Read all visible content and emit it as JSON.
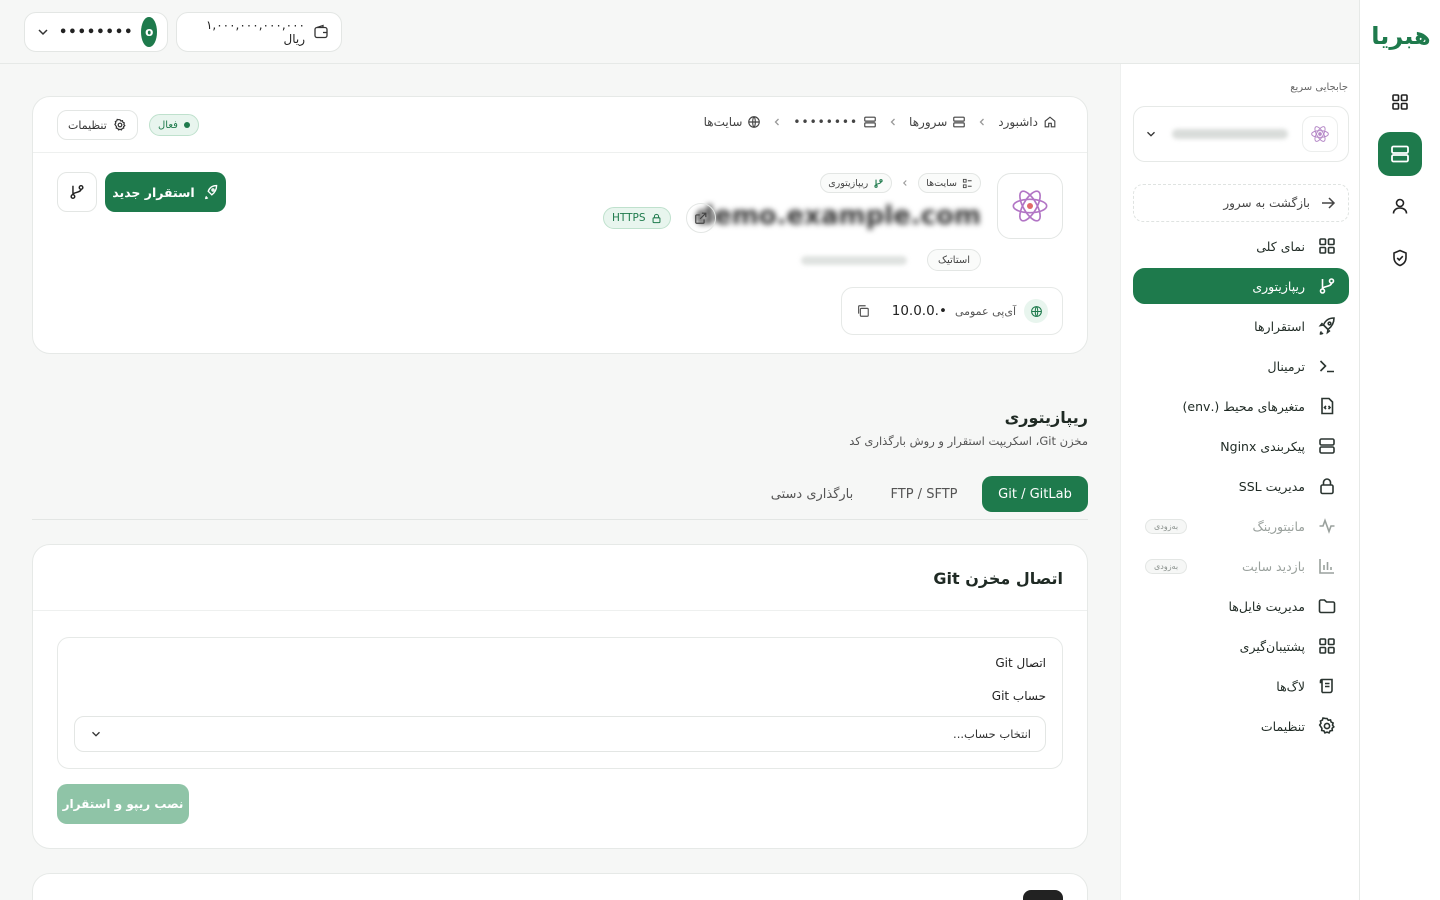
{
  "topbar": {
    "user": {
      "avatar_initial": "o",
      "name": "••••••••"
    },
    "wallet": {
      "balance": "۱,۰۰۰,۰۰۰,۰۰۰,۰۰۰ ریال"
    }
  },
  "rail": {
    "logo": "هبریا",
    "items": [
      {
        "icon": "grid-icon",
        "active": false
      },
      {
        "icon": "server-icon",
        "active": true
      },
      {
        "icon": "user-icon",
        "active": false
      },
      {
        "icon": "shield-icon",
        "active": false
      }
    ]
  },
  "sidebar": {
    "quick_switch_label": "جابجایی سریع",
    "back_label": "بازگشت به سرور",
    "items": [
      {
        "label": "نمای کلی",
        "icon": "grid-icon"
      },
      {
        "label": "ریپازیتوری",
        "icon": "git-branch-icon",
        "active": true
      },
      {
        "label": "استقرارها",
        "icon": "rocket-icon"
      },
      {
        "label": "ترمینال",
        "icon": "terminal-icon"
      },
      {
        "label": "متغیرهای محیط (.env)",
        "icon": "file-code-icon"
      },
      {
        "label": "پیکربندی Nginx",
        "icon": "server-icon"
      },
      {
        "label": "مدیریت SSL",
        "icon": "lock-icon"
      },
      {
        "label": "مانیتورینگ",
        "icon": "activity-icon",
        "disabled": true,
        "badge": "به‌زودی"
      },
      {
        "label": "بازدید سایت",
        "icon": "bar-chart-icon",
        "disabled": true,
        "badge": "به‌زودی"
      },
      {
        "label": "مدیریت فایل‌ها",
        "icon": "folder-icon"
      },
      {
        "label": "پشتیبان‌گیری",
        "icon": "grid-icon"
      },
      {
        "label": "لاگ‌ها",
        "icon": "scroll-icon"
      },
      {
        "label": "تنظیمات",
        "icon": "gear-icon"
      }
    ]
  },
  "header": {
    "breadcrumb": {
      "home": "داشبورد",
      "servers": "سرورها",
      "server": "••••••••",
      "sites": "سایت‌ها"
    },
    "status": "فعال",
    "settings_label": "تنظیمات",
    "chips": {
      "sites": "سایت‌ها",
      "repository": "ریپازیتوری"
    },
    "domain": "demo.example.com",
    "https": "HTTPS",
    "type": "استاتیک",
    "ip_label": "آی‌پی عمومی",
    "ip_value": "10.0.0.•",
    "deploy_label": "استقرار جدید"
  },
  "section": {
    "title": "ریپازیتوری",
    "subtitle": "مخزن Git، اسکریپت استقرار و روش بارگذاری کد"
  },
  "tabs": [
    {
      "label": "Git / GitLab",
      "active": true
    },
    {
      "label": "FTP / SFTP"
    },
    {
      "label": "بارگذاری دستی"
    }
  ],
  "git_card": {
    "title": "اتصال مخزن Git",
    "connection_label": "اتصال Git",
    "account_label": "حساب Git",
    "account_placeholder": "انتخاب حساب...",
    "install_label": "نصب ریپو و استقرار"
  },
  "colors": {
    "brand": "#1e7a4c",
    "brand_light": "#e8f5ee",
    "disabled_button": "#8fc4a7"
  }
}
